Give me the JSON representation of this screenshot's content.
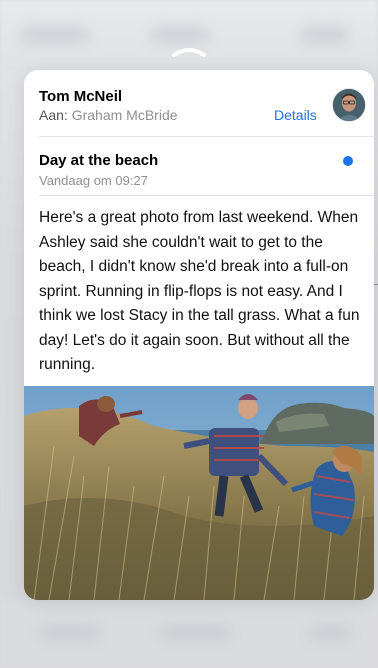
{
  "email": {
    "sender": "Tom McNeil",
    "to_label": "Aan:",
    "recipient": "Graham McBride",
    "details_label": "Details",
    "subject": "Day at the beach",
    "date": "Vandaag om 09:27",
    "body": "Here's a great photo from last weekend. When Ashley said she couldn't wait to get to the beach, I didn't know she'd break into a full-on sprint. Running in flip-flops is not easy. And I think we lost Stacy in the tall grass. What a fun day! Let's do it again soon. But without all the running.",
    "unread": true,
    "accent_color": "#1a73e8"
  },
  "icons": {
    "handle": "chevron-up-icon",
    "avatar": "avatar",
    "unread": "unread-dot-icon"
  }
}
